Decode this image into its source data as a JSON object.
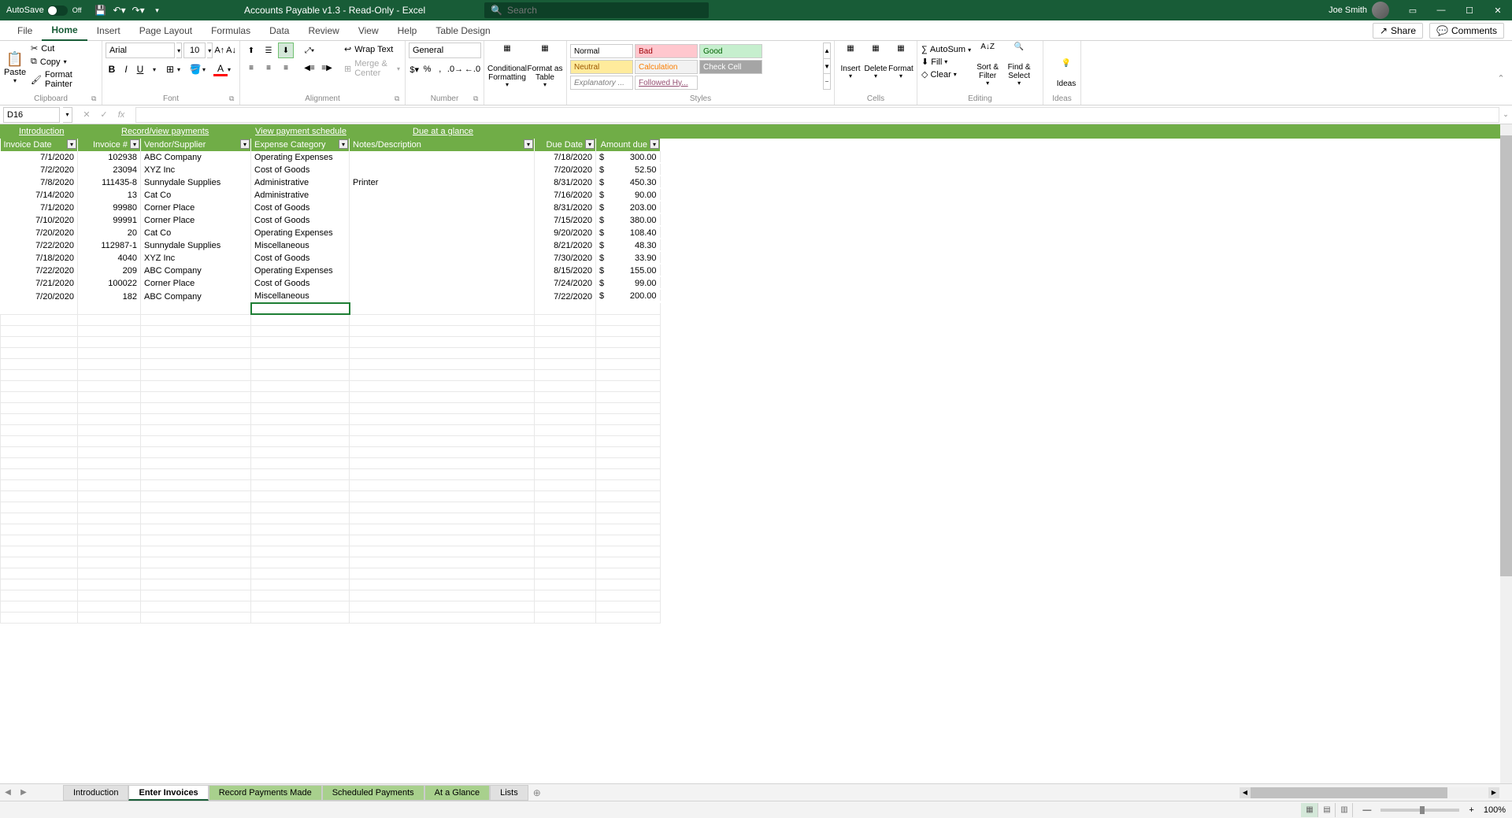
{
  "titleBar": {
    "autosave": "AutoSave",
    "autosave_state": "Off",
    "docTitle": "Accounts Payable v1.3  -  Read-Only  -  Excel",
    "searchPlaceholder": "Search",
    "userName": "Joe Smith"
  },
  "ribbonTabs": [
    "File",
    "Home",
    "Insert",
    "Page Layout",
    "Formulas",
    "Data",
    "Review",
    "View",
    "Help",
    "Table Design"
  ],
  "ribbonRight": {
    "share": "Share",
    "comments": "Comments"
  },
  "clipboard": {
    "paste": "Paste",
    "cut": "Cut",
    "copy": "Copy",
    "formatPainter": "Format Painter",
    "label": "Clipboard"
  },
  "font": {
    "name": "Arial",
    "size": "10",
    "label": "Font"
  },
  "alignment": {
    "wrap": "Wrap Text",
    "merge": "Merge & Center",
    "label": "Alignment"
  },
  "number": {
    "format": "General",
    "label": "Number"
  },
  "condFmt": {
    "conditional": "Conditional Formatting",
    "formatAs": "Format as Table"
  },
  "styles": {
    "label": "Styles",
    "items": [
      {
        "text": "Normal",
        "bg": "#ffffff",
        "color": "#000"
      },
      {
        "text": "Bad",
        "bg": "#ffc7ce",
        "color": "#9c0006"
      },
      {
        "text": "Good",
        "bg": "#c6efce",
        "color": "#006100"
      },
      {
        "text": "Neutral",
        "bg": "#ffeb9c",
        "color": "#9c5700"
      },
      {
        "text": "Calculation",
        "bg": "#f2f2f2",
        "color": "#fa7d00"
      },
      {
        "text": "Check Cell",
        "bg": "#a5a5a5",
        "color": "#ffffff"
      },
      {
        "text": "Explanatory ...",
        "bg": "#ffffff",
        "color": "#7f7f7f",
        "italic": true
      },
      {
        "text": "Followed Hy...",
        "bg": "#ffffff",
        "color": "#954f72",
        "underline": true
      }
    ]
  },
  "cells": {
    "insert": "Insert",
    "delete": "Delete",
    "format": "Format",
    "label": "Cells"
  },
  "editing": {
    "autosum": "AutoSum",
    "fill": "Fill",
    "clear": "Clear",
    "sortFilter": "Sort & Filter",
    "findSelect": "Find & Select",
    "label": "Editing"
  },
  "ideas": {
    "label": "Ideas",
    "btn": "Ideas"
  },
  "formulaBar": {
    "nameBox": "D16",
    "formula": ""
  },
  "navLinks": [
    "Introduction",
    "Record/view payments",
    "View payment schedule",
    "Due at a glance"
  ],
  "navLinkPositions": [
    20,
    150,
    320,
    520
  ],
  "tableHeaders": [
    "Invoice Date",
    "Invoice #",
    "Vendor/Supplier",
    "Expense Category",
    "Notes/Description",
    "Due Date",
    "Amount due"
  ],
  "tableData": [
    {
      "invDate": "7/1/2020",
      "invNum": "102938",
      "vendor": "ABC Company",
      "category": "Operating Expenses",
      "notes": "",
      "dueDate": "7/18/2020",
      "amount": "300.00"
    },
    {
      "invDate": "7/2/2020",
      "invNum": "23094",
      "vendor": "XYZ Inc",
      "category": "Cost of Goods",
      "notes": "",
      "dueDate": "7/20/2020",
      "amount": "52.50"
    },
    {
      "invDate": "7/8/2020",
      "invNum": "111435-8",
      "vendor": "Sunnydale Supplies",
      "category": "Administrative",
      "notes": "Printer",
      "dueDate": "8/31/2020",
      "amount": "450.30"
    },
    {
      "invDate": "7/14/2020",
      "invNum": "13",
      "vendor": "Cat Co",
      "category": "Administrative",
      "notes": "",
      "dueDate": "7/16/2020",
      "amount": "90.00"
    },
    {
      "invDate": "7/1/2020",
      "invNum": "99980",
      "vendor": "Corner Place",
      "category": "Cost of Goods",
      "notes": "",
      "dueDate": "8/31/2020",
      "amount": "203.00"
    },
    {
      "invDate": "7/10/2020",
      "invNum": "99991",
      "vendor": "Corner Place",
      "category": "Cost of Goods",
      "notes": "",
      "dueDate": "7/15/2020",
      "amount": "380.00"
    },
    {
      "invDate": "7/20/2020",
      "invNum": "20",
      "vendor": "Cat Co",
      "category": "Operating Expenses",
      "notes": "",
      "dueDate": "9/20/2020",
      "amount": "108.40"
    },
    {
      "invDate": "7/22/2020",
      "invNum": "112987-1",
      "vendor": "Sunnydale Supplies",
      "category": "Miscellaneous",
      "notes": "",
      "dueDate": "8/21/2020",
      "amount": "48.30"
    },
    {
      "invDate": "7/18/2020",
      "invNum": "4040",
      "vendor": "XYZ Inc",
      "category": "Cost of Goods",
      "notes": "",
      "dueDate": "7/30/2020",
      "amount": "33.90"
    },
    {
      "invDate": "7/22/2020",
      "invNum": "209",
      "vendor": "ABC Company",
      "category": "Operating Expenses",
      "notes": "",
      "dueDate": "8/15/2020",
      "amount": "155.00"
    },
    {
      "invDate": "7/21/2020",
      "invNum": "100022",
      "vendor": "Corner Place",
      "category": "Cost of Goods",
      "notes": "",
      "dueDate": "7/24/2020",
      "amount": "99.00"
    },
    {
      "invDate": "7/20/2020",
      "invNum": "182",
      "vendor": "ABC Company",
      "category": "Miscellaneous",
      "notes": "",
      "dueDate": "7/22/2020",
      "amount": "200.00"
    }
  ],
  "currency": "$",
  "sheetTabs": [
    {
      "name": "Introduction",
      "class": ""
    },
    {
      "name": "Enter Invoices",
      "class": "active"
    },
    {
      "name": "Record Payments Made",
      "class": "green"
    },
    {
      "name": "Scheduled Payments",
      "class": "green"
    },
    {
      "name": "At a Glance",
      "class": "green"
    },
    {
      "name": "Lists",
      "class": ""
    }
  ],
  "statusBar": {
    "zoom": "100%"
  }
}
